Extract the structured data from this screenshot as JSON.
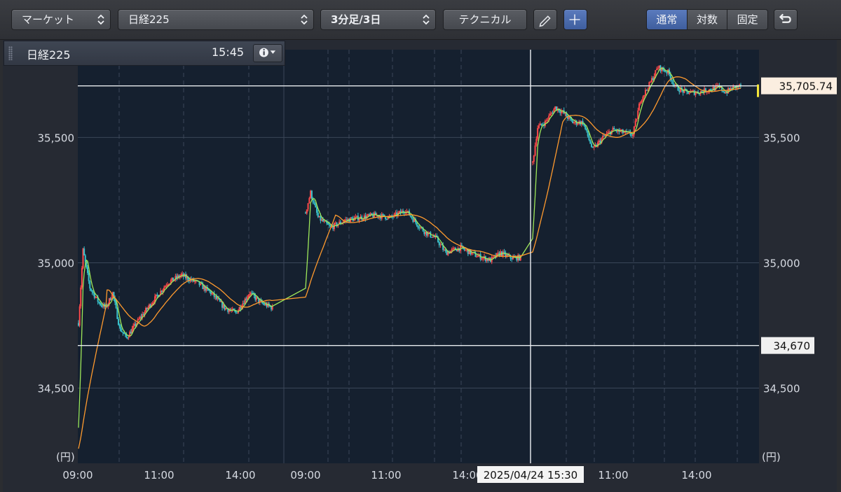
{
  "toolbar": {
    "market_select": "マーケット",
    "symbol_select": "日経225",
    "period_select": "3分足/3日",
    "technical_button": "テクニカル",
    "scale_modes": [
      "通常",
      "対数",
      "固定"
    ],
    "active_scale_mode": "通常"
  },
  "info_panel": {
    "symbol": "日経225",
    "time": "15:45"
  },
  "chart_data": {
    "type": "candlestick",
    "unit_label": "(円)",
    "y_ticks": [
      34500,
      35000,
      35500
    ],
    "y_tick_labels": [
      "34,500",
      "35,000",
      "35,500"
    ],
    "ylim": [
      34200,
      35850
    ],
    "x_tick_labels": [
      "09:00",
      "11:00",
      "14:00",
      "09:00",
      "11:00",
      "14:00",
      "11:00",
      "14:00"
    ],
    "sessions": [
      {
        "anchors": [
          [
            0,
            34760
          ],
          [
            4,
            35050
          ],
          [
            10,
            34900
          ],
          [
            18,
            34840
          ],
          [
            24,
            34820
          ],
          [
            30,
            34880
          ],
          [
            36,
            34740
          ],
          [
            42,
            34700
          ],
          [
            54,
            34780
          ],
          [
            64,
            34840
          ],
          [
            78,
            34920
          ],
          [
            90,
            34950
          ],
          [
            104,
            34920
          ],
          [
            116,
            34880
          ],
          [
            128,
            34820
          ],
          [
            138,
            34800
          ],
          [
            150,
            34880
          ],
          [
            160,
            34840
          ],
          [
            170,
            34820
          ]
        ]
      },
      {
        "anchors": [
          [
            0,
            35200
          ],
          [
            4,
            35280
          ],
          [
            10,
            35180
          ],
          [
            20,
            35140
          ],
          [
            32,
            35170
          ],
          [
            44,
            35180
          ],
          [
            56,
            35190
          ],
          [
            68,
            35180
          ],
          [
            80,
            35210
          ],
          [
            90,
            35150
          ],
          [
            96,
            35120
          ],
          [
            104,
            35100
          ],
          [
            112,
            35040
          ],
          [
            124,
            35060
          ],
          [
            136,
            35030
          ],
          [
            148,
            35010
          ],
          [
            156,
            35040
          ],
          [
            164,
            35020
          ],
          [
            172,
            35020
          ]
        ]
      },
      {
        "anchors": [
          [
            0,
            35400
          ],
          [
            4,
            35540
          ],
          [
            10,
            35560
          ],
          [
            18,
            35620
          ],
          [
            24,
            35600
          ],
          [
            32,
            35560
          ],
          [
            40,
            35560
          ],
          [
            48,
            35450
          ],
          [
            56,
            35500
          ],
          [
            64,
            35530
          ],
          [
            72,
            35520
          ],
          [
            80,
            35510
          ],
          [
            86,
            35650
          ],
          [
            92,
            35700
          ],
          [
            100,
            35780
          ],
          [
            108,
            35760
          ],
          [
            114,
            35700
          ],
          [
            122,
            35680
          ],
          [
            132,
            35680
          ],
          [
            140,
            35690
          ],
          [
            148,
            35700
          ],
          [
            154,
            35680
          ],
          [
            160,
            35700
          ],
          [
            166,
            35705
          ]
        ]
      }
    ],
    "moving_averages": [
      {
        "color": "#9ee85a",
        "period": 5
      },
      {
        "color": "#ff9a2e",
        "period": 25
      }
    ],
    "horizontal_lines": [
      {
        "value": 35705.74,
        "label": "35,705.74"
      },
      {
        "value": 34670,
        "label": "34,670"
      }
    ],
    "crosshair_time_label": "2025/04/24 15:30",
    "colors": {
      "plot_bg": "#15202f",
      "grid": "#3a4658",
      "up": "#ff4a4a",
      "down": "#39c2cc"
    }
  }
}
